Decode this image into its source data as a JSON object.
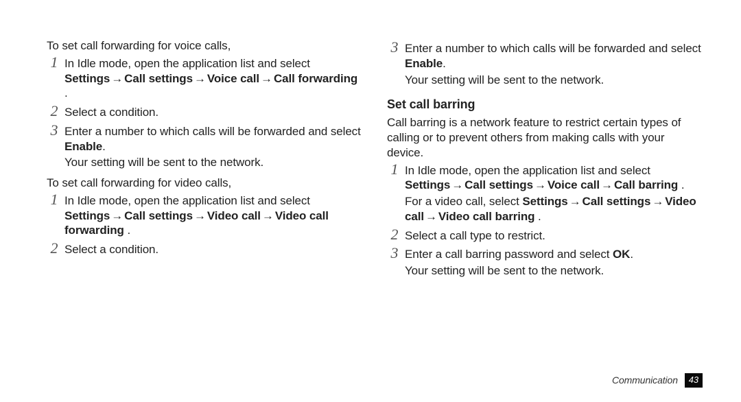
{
  "arrow": "→",
  "footer": {
    "section": "Communication",
    "page": "43"
  },
  "left": {
    "intro1": "To set call forwarding for voice calls,",
    "s1": {
      "n": "1",
      "t": "In Idle mode, open the application list and select ",
      "path": [
        "Settings",
        "Call settings",
        "Voice call",
        "Call forwarding"
      ],
      "dot": "."
    },
    "s2": {
      "n": "2",
      "t": "Select a condition."
    },
    "s3": {
      "n": "3",
      "t1": "Enter a number to which calls will be forwarded and select ",
      "enable": "Enable",
      "dot": ".",
      "after": "Your setting will be sent to the network."
    },
    "intro2": "To set call forwarding for video calls,",
    "s4": {
      "n": "1",
      "t": "In Idle mode, open the application list and select ",
      "path": [
        "Settings",
        "Call settings",
        "Video call",
        "Video call forwarding"
      ],
      "dot": "."
    },
    "s5": {
      "n": "2",
      "t": "Select a condition."
    }
  },
  "right": {
    "s3b": {
      "n": "3",
      "t1": "Enter a number to which calls will be forwarded and select ",
      "enable": "Enable",
      "dot": ".",
      "after": "Your setting will be sent to the network."
    },
    "h": "Set call barring",
    "intro": "Call barring is a network feature to restrict certain types of calling or to prevent others from making calls with your device.",
    "b1": {
      "n": "1",
      "t": "In Idle mode, open the application list and select ",
      "path": [
        "Settings",
        "Call settings",
        "Voice call",
        "Call barring"
      ],
      "dot": ".",
      "vidPrefix": "For a video call, select ",
      "vidPath": [
        "Settings",
        "Call settings",
        "Video call",
        "Video call barring"
      ],
      "vidDot": "."
    },
    "b2": {
      "n": "2",
      "t": "Select a call type to restrict."
    },
    "b3": {
      "n": "3",
      "t1": "Enter a call barring password and select ",
      "ok": "OK",
      "dot": ".",
      "after": "Your setting will be sent to the network."
    }
  }
}
